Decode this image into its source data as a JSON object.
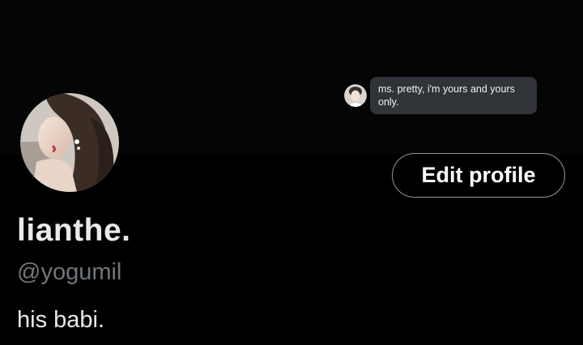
{
  "theme": {
    "background": "#000000",
    "text_primary": "#e7e9ea",
    "text_secondary": "#71767b",
    "button_border": "#8b98a5",
    "bubble_bg": "#303337"
  },
  "header": {
    "chat_bubble": {
      "avatar_icon": "user-photo",
      "text": "ms. pretty, i'm yours and yours only."
    }
  },
  "profile": {
    "avatar_icon": "profile-photo",
    "edit_button_label": "Edit profile",
    "display_name": "lianthe.",
    "username": "@yogumil",
    "bio": "his babi."
  }
}
